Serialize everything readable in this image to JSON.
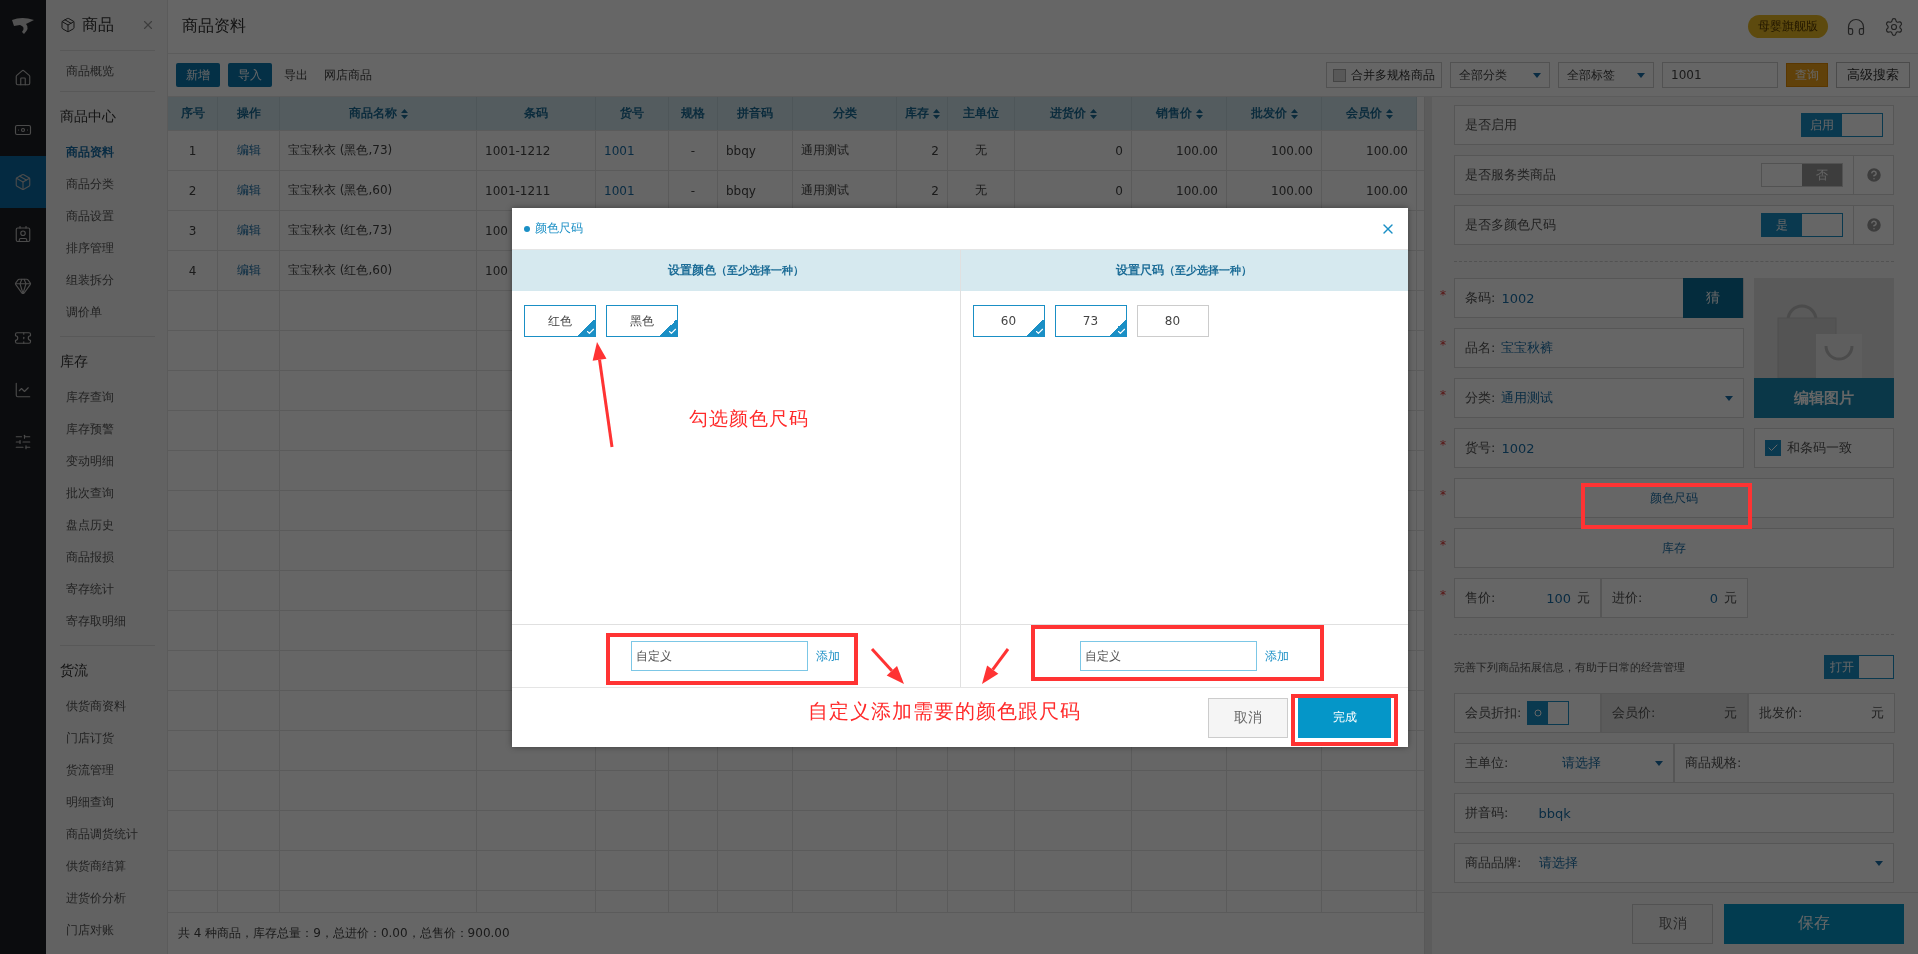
{
  "rail": {
    "items": [
      {
        "selected": false
      },
      {
        "selected": false
      },
      {
        "selected": true
      },
      {
        "selected": false
      },
      {
        "selected": false
      },
      {
        "selected": false
      },
      {
        "selected": false
      },
      {
        "selected": false
      }
    ]
  },
  "sidebar": {
    "title": "商品",
    "top_items": [
      {
        "label": "商品概览",
        "selected": false
      }
    ],
    "sections": [
      {
        "heading": "商品中心",
        "items": [
          {
            "label": "商品资料",
            "selected": true
          },
          {
            "label": "商品分类",
            "selected": false
          },
          {
            "label": "商品设置",
            "selected": false
          },
          {
            "label": "排序管理",
            "selected": false
          },
          {
            "label": "组装拆分",
            "selected": false
          },
          {
            "label": "调价单",
            "selected": false
          }
        ]
      },
      {
        "heading": "库存",
        "items": [
          {
            "label": "库存查询",
            "selected": false
          },
          {
            "label": "库存预警",
            "selected": false
          },
          {
            "label": "变动明细",
            "selected": false
          },
          {
            "label": "批次查询",
            "selected": false
          },
          {
            "label": "盘点历史",
            "selected": false
          },
          {
            "label": "商品报损",
            "selected": false
          },
          {
            "label": "寄存统计",
            "selected": false
          },
          {
            "label": "寄存取明细",
            "selected": false
          }
        ]
      },
      {
        "heading": "货流",
        "items": [
          {
            "label": "供货商资料",
            "selected": false
          },
          {
            "label": "门店订货",
            "selected": false
          },
          {
            "label": "货流管理",
            "selected": false
          },
          {
            "label": "明细查询",
            "selected": false
          },
          {
            "label": "商品调货统计",
            "selected": false
          },
          {
            "label": "供货商结算",
            "selected": false
          },
          {
            "label": "进货价分析",
            "selected": false
          },
          {
            "label": "门店对账",
            "selected": false
          }
        ]
      }
    ]
  },
  "header": {
    "title": "商品资料",
    "edition": "母婴旗舰版"
  },
  "toolbar": {
    "buttons": [
      {
        "label": "新增",
        "kind": "primary"
      },
      {
        "label": "导入",
        "kind": "primary"
      },
      {
        "label": "导出",
        "kind": "link"
      },
      {
        "label": "网店商品",
        "kind": "link"
      }
    ],
    "merge": {
      "label": "合并多规格商品",
      "checked": false
    },
    "category": "全部分类",
    "tag": "全部标签",
    "search": {
      "value": "1001"
    },
    "query": "查询",
    "advanced": "高级搜索"
  },
  "table": {
    "columns": [
      {
        "label": "序号",
        "kind": "center",
        "sortable": false
      },
      {
        "label": "操作",
        "kind": "action",
        "sortable": false
      },
      {
        "label": "商品名称",
        "kind": "text",
        "sortable": true
      },
      {
        "label": "条码",
        "kind": "text",
        "sortable": false
      },
      {
        "label": "货号",
        "kind": "link",
        "sortable": false
      },
      {
        "label": "规格",
        "kind": "center",
        "sortable": false
      },
      {
        "label": "拼音码",
        "kind": "text",
        "sortable": false
      },
      {
        "label": "分类",
        "kind": "text",
        "sortable": false
      },
      {
        "label": "库存",
        "kind": "number",
        "sortable": true
      },
      {
        "label": "主单位",
        "kind": "center",
        "sortable": false
      },
      {
        "label": "进货价",
        "kind": "number",
        "sortable": true
      },
      {
        "label": "销售价",
        "kind": "number",
        "sortable": true
      },
      {
        "label": "批发价",
        "kind": "number",
        "sortable": true
      },
      {
        "label": "会员价",
        "kind": "number",
        "sortable": true
      }
    ],
    "rows": [
      [
        "1",
        "编辑",
        "宝宝秋衣 (黑色,73)",
        "1001-1212",
        "1001",
        "-",
        "bbqy",
        "通用测试",
        "2",
        "无",
        "0",
        "100.00",
        "100.00",
        "100.00"
      ],
      [
        "2",
        "编辑",
        "宝宝秋衣 (黑色,60)",
        "1001-1211",
        "1001",
        "-",
        "bbqy",
        "通用测试",
        "2",
        "无",
        "0",
        "100.00",
        "100.00",
        "100.00"
      ],
      [
        "3",
        "编辑",
        "宝宝秋衣 (红色,73)",
        "100"
      ],
      [
        "4",
        "编辑",
        "宝宝秋衣 (红色,60)",
        "100"
      ]
    ],
    "summary": "共 4 种商品，库存总量：9，总进价：0.00，总售价：900.00"
  },
  "panel": {
    "switches": [
      {
        "label": "是否启用",
        "on": true,
        "text": "启用",
        "help": false
      },
      {
        "label": "是否服务类商品",
        "on": false,
        "text": "否",
        "help": true
      },
      {
        "label": "是否多颜色尺码",
        "on": true,
        "text": "是",
        "help": true
      }
    ],
    "barcode": {
      "mark": "*",
      "label": "条码:",
      "value": "1002",
      "button": "猜"
    },
    "name": {
      "mark": "*",
      "label": "品名:",
      "value": "宝宝秋裤"
    },
    "category": {
      "mark": "*",
      "label": "分类:",
      "value": "通用测试"
    },
    "item_no": {
      "mark": "*",
      "label": "货号:",
      "value": "1002"
    },
    "image_button": "编辑图片",
    "same_as_barcode": {
      "label": "和条码一致",
      "checked": true
    },
    "color_size": {
      "mark": "*",
      "label": "颜色尺码"
    },
    "stock": {
      "mark": "*",
      "label": "库存"
    },
    "prices": {
      "mark": "*",
      "sale": {
        "label": "售价:",
        "value": "100",
        "unit": "元"
      },
      "cost": {
        "label": "进价:",
        "value": "0",
        "unit": "元"
      }
    },
    "extra": {
      "hint": "完善下列商品拓展信息，有助于日常的经营管理",
      "toggle": {
        "on": true,
        "text": "打开"
      },
      "member_discount": {
        "label": "会员折扣:",
        "on": true
      },
      "member_price": {
        "label": "会员价:",
        "unit": "元",
        "disabled": true
      },
      "wholesale": {
        "label": "批发价:",
        "unit": "元",
        "disabled": false
      },
      "unit": {
        "label": "主单位:",
        "value": "请选择"
      },
      "spec": {
        "label": "商品规格:"
      },
      "pinyin": {
        "label": "拼音码:",
        "value": "bbqk"
      },
      "brand": {
        "label": "商品品牌:",
        "value": "请选择"
      }
    },
    "cancel": "取消",
    "save": "保存"
  },
  "modal": {
    "title": "颜色尺码",
    "groups": [
      {
        "heading": "设置颜色",
        "hint": "（至少选择一种）",
        "options": [
          {
            "label": "红色",
            "selected": true
          },
          {
            "label": "黑色",
            "selected": true
          }
        ],
        "custom": {
          "placeholder": "自定义"
        },
        "add": "添加"
      },
      {
        "heading": "设置尺码",
        "hint": "（至少选择一种）",
        "options": [
          {
            "label": "60",
            "selected": true
          },
          {
            "label": "73",
            "selected": true
          },
          {
            "label": "80",
            "selected": false
          }
        ],
        "custom": {
          "placeholder": "自定义"
        },
        "add": "添加"
      }
    ],
    "cancel": "取消",
    "confirm": "完成"
  },
  "annotations": {
    "notes": [
      "勾选颜色尺码",
      "自定义添加需要的颜色跟尺码"
    ]
  }
}
